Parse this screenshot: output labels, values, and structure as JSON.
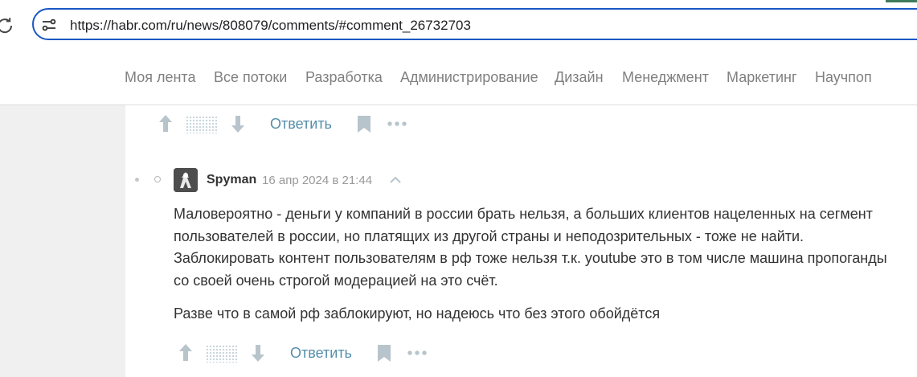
{
  "browser": {
    "url": "https://habr.com/ru/news/808079/comments/#comment_26732703"
  },
  "nav": {
    "items": [
      {
        "label": "Моя лента"
      },
      {
        "label": "Все потоки"
      },
      {
        "label": "Разработка"
      },
      {
        "label": "Администрирование"
      },
      {
        "label": "Дизайн"
      },
      {
        "label": "Менеджмент"
      },
      {
        "label": "Маркетинг"
      },
      {
        "label": "Научпоп"
      }
    ]
  },
  "prev_comment_actions": {
    "reply_label": "Ответить"
  },
  "comment": {
    "author": "Spyman",
    "date": "16 апр 2024 в 21:44",
    "paragraphs": [
      "Маловероятно - деньги у компаний в россии брать нельзя, а больших клиентов нацеленных на сегмент пользователей в россии, но платящих из другой страны и неподозрительных - тоже не найти. Заблокировать контент пользователям в рф тоже нельзя т.к. youtube это в том числе машина пропоганды со своей очень строгой модерацией на это счёт.",
      "Разве что в самой рф заблокируют, но надеюсь что без этого обойдётся"
    ],
    "reply_label": "Ответить"
  },
  "colors": {
    "omnibox_border": "#1a57c5",
    "nav_text": "#808080",
    "reply_link": "#548eaa",
    "icon_gray": "#b8c4cb",
    "page_bg": "#f0f0f0"
  }
}
